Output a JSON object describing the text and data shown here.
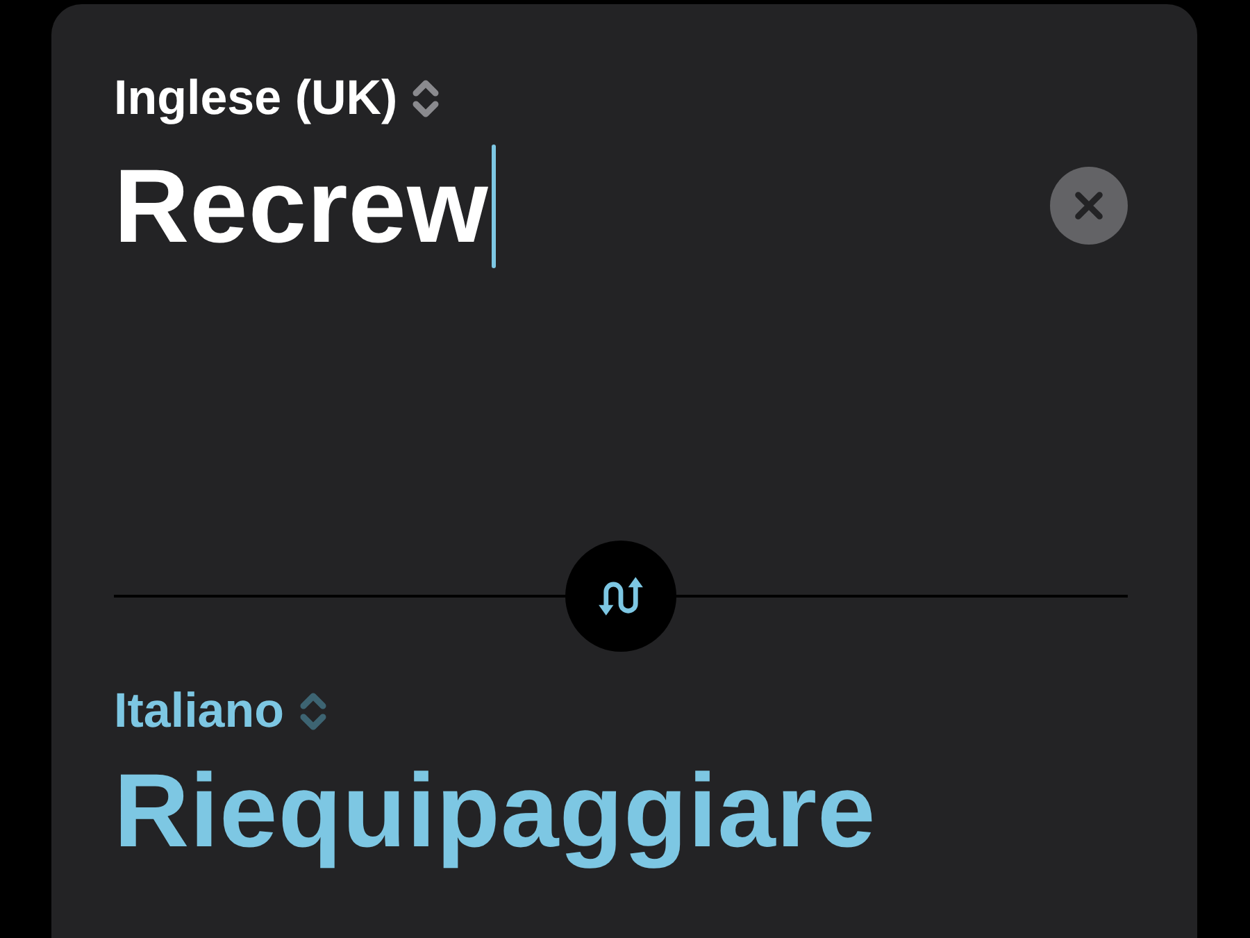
{
  "source": {
    "language": "Inglese (UK)",
    "value": "Recrew",
    "focused": true
  },
  "target": {
    "language": "Italiano",
    "text": "Riequipaggiare"
  }
}
